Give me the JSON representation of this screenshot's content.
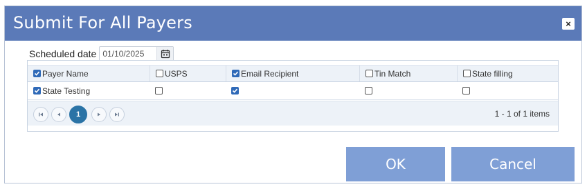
{
  "dialog": {
    "title": "Submit For All Payers",
    "close_label": "×"
  },
  "schedule": {
    "label": "Scheduled date",
    "date_value": "01/10/2025"
  },
  "grid": {
    "columns": [
      {
        "label": "Payer Name",
        "checked": true
      },
      {
        "label": "USPS",
        "checked": false
      },
      {
        "label": "Email Recipient",
        "checked": true
      },
      {
        "label": "Tin Match",
        "checked": false
      },
      {
        "label": "State filling",
        "checked": false
      }
    ],
    "rows": [
      {
        "payer_name": "State Testing",
        "payer_checked": true,
        "usps": false,
        "email_recipient": true,
        "tin_match": false,
        "state_filling": false
      }
    ]
  },
  "pager": {
    "current_page": "1",
    "info": "1 - 1 of 1 items"
  },
  "buttons": {
    "ok": "OK",
    "cancel": "Cancel"
  },
  "colors": {
    "titlebar": "#5b7ab8",
    "button": "#7f9fd6",
    "checkbox_checked": "#2f6ab8",
    "pager_current": "#2a73a6"
  }
}
